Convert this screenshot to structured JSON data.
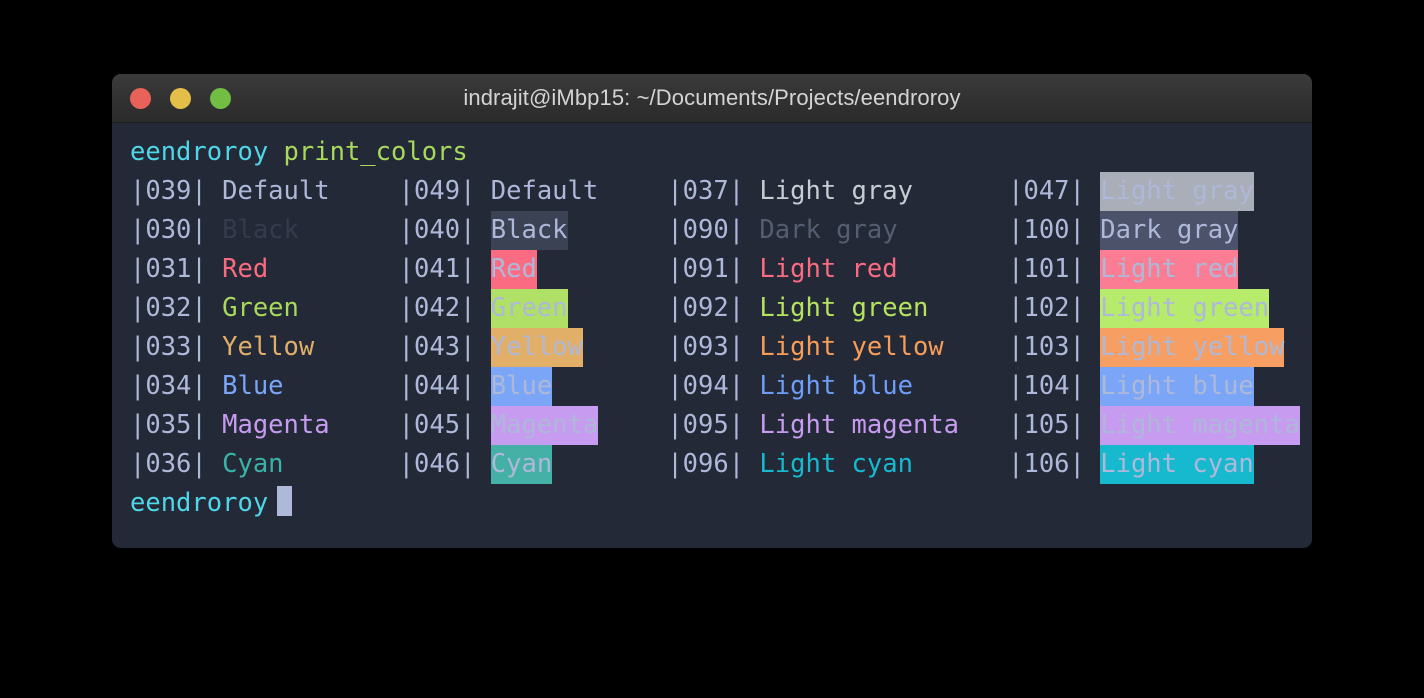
{
  "window": {
    "title": "indrajit@iMbp15: ~/Documents/Projects/eendroroy",
    "traffic_lights": [
      {
        "name": "close",
        "color": "#e8625a"
      },
      {
        "name": "minimize",
        "color": "#e3bf49"
      },
      {
        "name": "zoom",
        "color": "#72bd43"
      }
    ]
  },
  "terminal": {
    "prompt_top": {
      "user": "eendroroy",
      "command": "print_colors"
    },
    "prompt_bottom": {
      "user": "eendroroy",
      "command": ""
    },
    "colors": {
      "background": "#232936",
      "default_fg": "#aeb8d9",
      "cursor": "#aeb8d9",
      "prompt_user": "#4fd6e8",
      "prompt_command": "#a8d85c"
    },
    "rows": [
      {
        "c1": {
          "code": "|039|",
          "label": "Default"
        },
        "c2": {
          "code": "|049|",
          "label": "Default"
        },
        "c3": {
          "code": "|037|",
          "label": "Light gray"
        },
        "c4": {
          "code": "|047|",
          "label": "Light gray"
        }
      },
      {
        "c1": {
          "code": "|030|",
          "label": "Black"
        },
        "c2": {
          "code": "|040|",
          "label": "Black"
        },
        "c3": {
          "code": "|090|",
          "label": "Dark gray"
        },
        "c4": {
          "code": "|100|",
          "label": "Dark gray"
        }
      },
      {
        "c1": {
          "code": "|031|",
          "label": "Red"
        },
        "c2": {
          "code": "|041|",
          "label": "Red"
        },
        "c3": {
          "code": "|091|",
          "label": "Light red"
        },
        "c4": {
          "code": "|101|",
          "label": "Light red"
        }
      },
      {
        "c1": {
          "code": "|032|",
          "label": "Green"
        },
        "c2": {
          "code": "|042|",
          "label": "Green"
        },
        "c3": {
          "code": "|092|",
          "label": "Light green"
        },
        "c4": {
          "code": "|102|",
          "label": "Light green"
        }
      },
      {
        "c1": {
          "code": "|033|",
          "label": "Yellow"
        },
        "c2": {
          "code": "|043|",
          "label": "Yellow"
        },
        "c3": {
          "code": "|093|",
          "label": "Light yellow"
        },
        "c4": {
          "code": "|103|",
          "label": "Light yellow"
        }
      },
      {
        "c1": {
          "code": "|034|",
          "label": "Blue"
        },
        "c2": {
          "code": "|044|",
          "label": "Blue"
        },
        "c3": {
          "code": "|094|",
          "label": "Light blue"
        },
        "c4": {
          "code": "|104|",
          "label": "Light blue"
        }
      },
      {
        "c1": {
          "code": "|035|",
          "label": "Magenta"
        },
        "c2": {
          "code": "|045|",
          "label": "Magenta"
        },
        "c3": {
          "code": "|095|",
          "label": "Light magenta"
        },
        "c4": {
          "code": "|105|",
          "label": "Light magenta"
        }
      },
      {
        "c1": {
          "code": "|036|",
          "label": "Cyan"
        },
        "c2": {
          "code": "|046|",
          "label": "Cyan"
        },
        "c3": {
          "code": "|096|",
          "label": "Light cyan"
        },
        "c4": {
          "code": "|106|",
          "label": "Light cyan"
        }
      }
    ]
  }
}
